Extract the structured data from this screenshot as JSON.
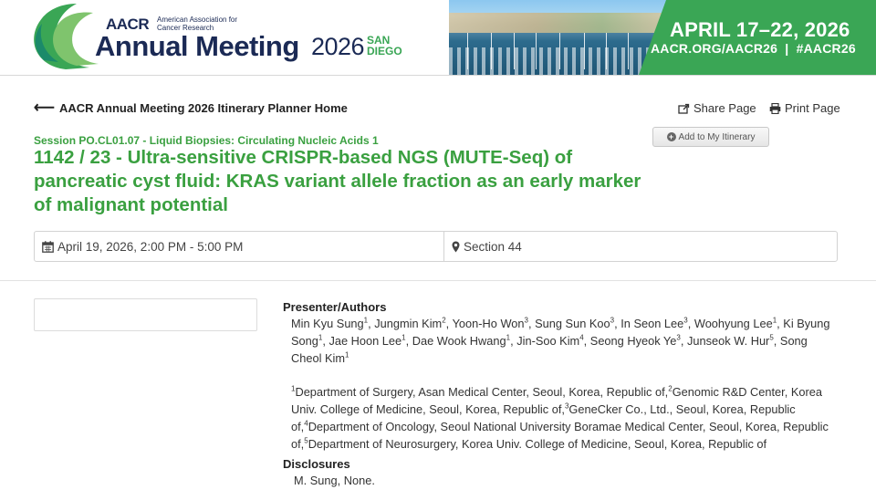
{
  "banner": {
    "org": "AACR",
    "org_assoc": "American Association for Cancer Research",
    "meeting": "Annual Meeting",
    "year": "2026",
    "city": "SAN DIEGO",
    "dates": "APRIL 17–22, 2026",
    "links": "AACR.ORG/AACR26  |  #AACR26",
    "colors": {
      "green": "#3aa655",
      "navy": "#1b2a55"
    }
  },
  "nav": {
    "home_link": "AACR Annual Meeting 2026 Itinerary Planner Home",
    "share": "Share Page",
    "print": "Print Page",
    "add_itinerary": "Add to My Itinerary"
  },
  "session": {
    "label": "Session PO.CL01.07 - Liquid Biopsies: Circulating Nucleic Acids 1",
    "title": "1142 / 23 - Ultra-sensitive CRISPR-based NGS (MUTE-Seq) of pancreatic cyst fluid: KRAS variant allele fraction as an early marker of malignant potential",
    "datetime": "April 19, 2026, 2:00 PM - 5:00 PM",
    "location": "Section 44"
  },
  "presenter": {
    "heading": "Presenter/Authors",
    "authors": [
      {
        "name": "Min Kyu Sung",
        "sup": "1"
      },
      {
        "name": "Jungmin Kim",
        "sup": "2"
      },
      {
        "name": "Yoon-Ho Won",
        "sup": "3"
      },
      {
        "name": "Sung Sun Koo",
        "sup": "3"
      },
      {
        "name": "In Seon Lee",
        "sup": "3"
      },
      {
        "name": "Woohyung Lee",
        "sup": "1"
      },
      {
        "name": "Ki Byung Song",
        "sup": "1"
      },
      {
        "name": "Jae Hoon Lee",
        "sup": "1"
      },
      {
        "name": "Dae Wook Hwang",
        "sup": "1"
      },
      {
        "name": "Jin-Soo Kim",
        "sup": "4"
      },
      {
        "name": "Seong Hyeok Ye",
        "sup": "3"
      },
      {
        "name": "Junseok W. Hur",
        "sup": "5"
      },
      {
        "name": "Song Cheol Kim",
        "sup": "1"
      }
    ],
    "affiliations": [
      {
        "sup": "1",
        "text": "Department of Surgery, Asan Medical Center, Seoul, Korea, Republic of,"
      },
      {
        "sup": "2",
        "text": "Genomic R&D Center, Korea Univ. College of Medicine, Seoul, Korea, Republic of,"
      },
      {
        "sup": "3",
        "text": "GeneCker Co., Ltd., Seoul, Korea, Republic of,"
      },
      {
        "sup": "4",
        "text": "Department of Oncology, Seoul National University Boramae Medical Center, Seoul, Korea, Republic of,"
      },
      {
        "sup": "5",
        "text": "Department of Neurosurgery, Korea Univ. College of Medicine, Seoul, Korea, Republic of"
      }
    ]
  },
  "disclosures": {
    "heading": "Disclosures",
    "name": "M. Sung,",
    "value": "None."
  }
}
